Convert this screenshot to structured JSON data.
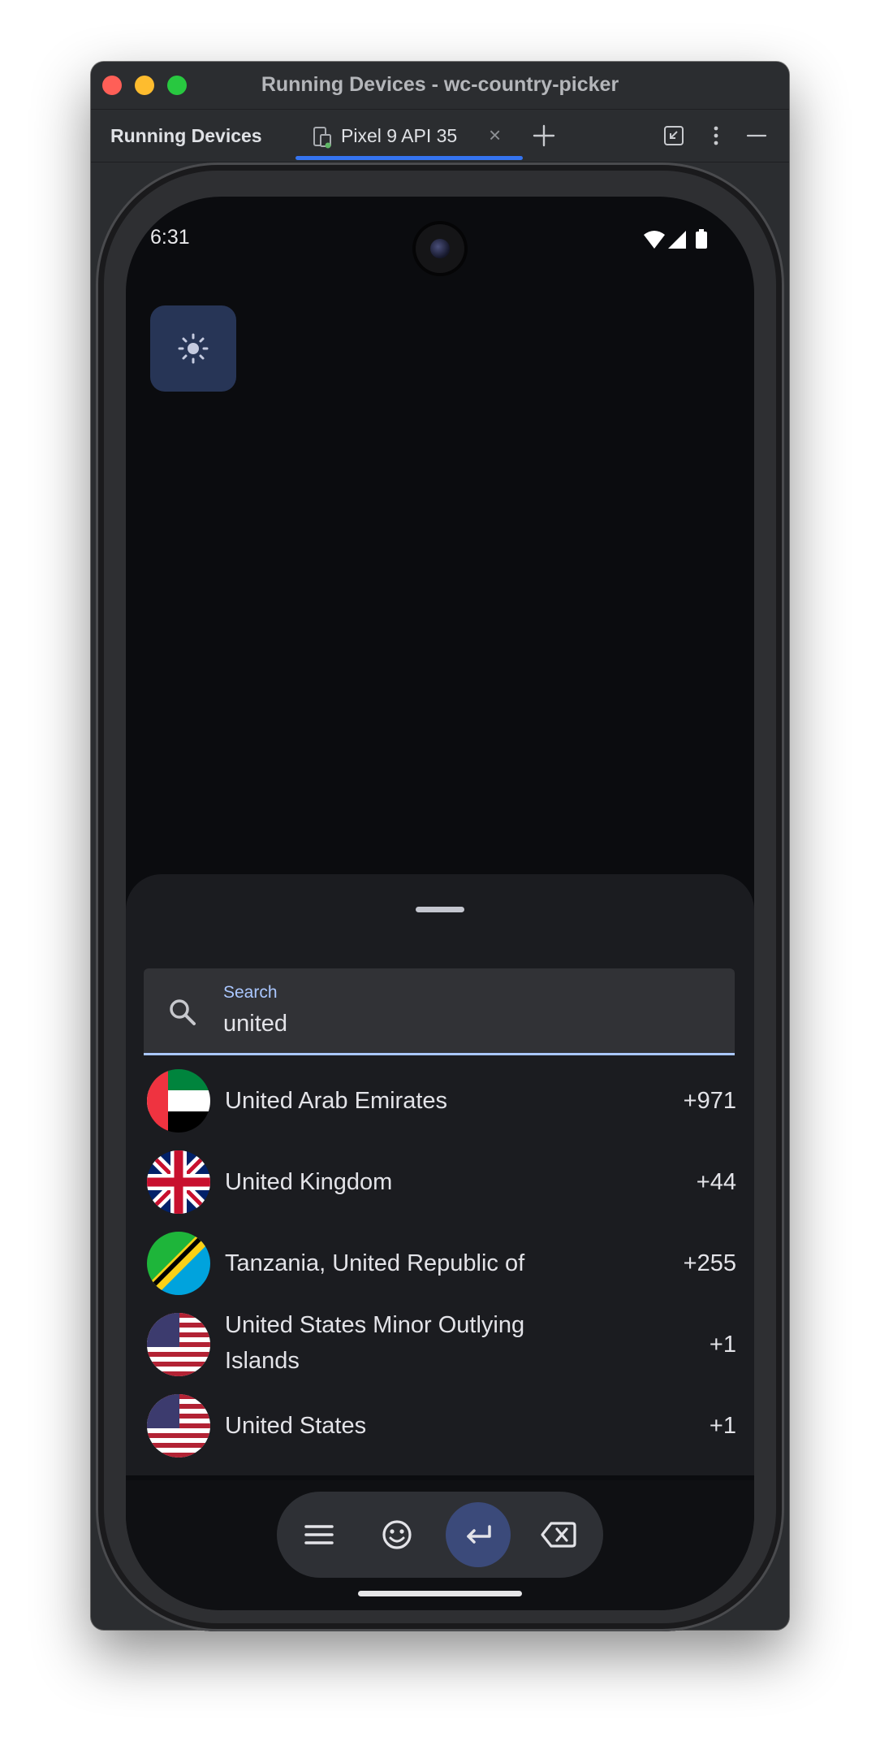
{
  "window": {
    "title": "Running Devices - wc-country-picker"
  },
  "toolbar": {
    "tool_title": "Running Devices",
    "device_tab_label": "Pixel 9 API 35",
    "close_glyph": "×",
    "add_glyph": "+"
  },
  "status_bar": {
    "time": "6:31"
  },
  "sheet": {
    "search": {
      "label": "Search",
      "value": "united"
    },
    "countries": [
      {
        "name": "United Arab Emirates",
        "code": "+971",
        "flag": "ae-flag"
      },
      {
        "name": "United Kingdom",
        "code": "+44",
        "flag": "gb-flag"
      },
      {
        "name": "Tanzania, United Republic of",
        "code": "+255",
        "flag": "tz-flag"
      },
      {
        "name": "United States Minor Outlying Islands",
        "code": "+1",
        "flag": "um-flag"
      },
      {
        "name": "United States",
        "code": "+1",
        "flag": "us-flag"
      }
    ]
  },
  "colors": {
    "accent": "#aac7ff",
    "sheet_bg": "#1b1c20",
    "toggle_bg": "#273556",
    "tab_underline": "#3574f0"
  }
}
